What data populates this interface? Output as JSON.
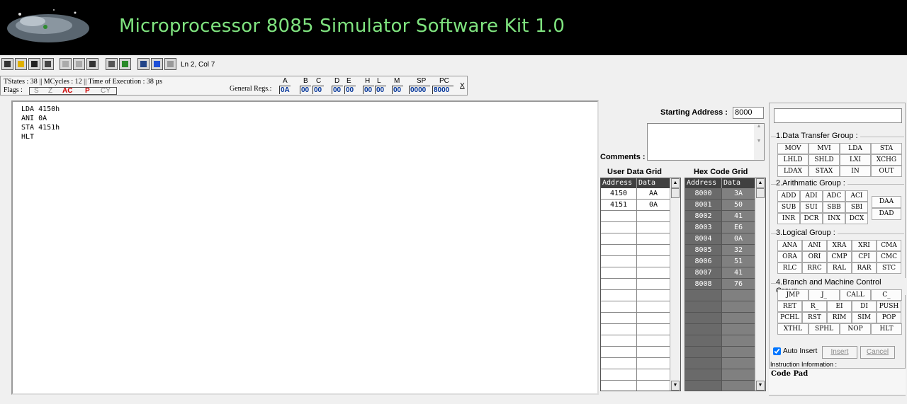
{
  "header": {
    "title": "Microprocessor 8085 Simulator Software Kit 1.0",
    "logo": "spaceship-logo"
  },
  "toolbar": {
    "icons": [
      "new-icon",
      "open-icon",
      "save-icon",
      "print-icon",
      "cut-icon",
      "copy-icon",
      "paste-icon",
      "timer-icon",
      "memory-icon",
      "compile-icon",
      "run-icon",
      "stop-icon"
    ],
    "cursor_pos": "Ln 2, Col 7"
  },
  "status": {
    "line": "TStates : 38 || MCycles : 12 || Time of Execution : 38 µs",
    "flags_label": "Flags :",
    "flags": [
      {
        "name": "S",
        "active": false
      },
      {
        "name": "Z",
        "active": false
      },
      {
        "name": "AC",
        "active": true
      },
      {
        "name": "P",
        "active": true
      },
      {
        "name": "CY",
        "active": false
      }
    ],
    "general_regs_label": "General Regs.:",
    "registers": [
      {
        "name": "A",
        "value": "0A"
      },
      {
        "name": "B",
        "value": "00"
      },
      {
        "name": "C",
        "value": "00"
      },
      {
        "name": "D",
        "value": "00"
      },
      {
        "name": "E",
        "value": "00"
      },
      {
        "name": "H",
        "value": "00"
      },
      {
        "name": "L",
        "value": "00"
      },
      {
        "name": "M",
        "value": "00"
      },
      {
        "name": "SP",
        "value": "0000"
      },
      {
        "name": "PC",
        "value": "8000"
      }
    ],
    "close_label": "X"
  },
  "editor": {
    "lines": [
      "LDA 4150h",
      "ANI 0A",
      "STA 4151h",
      "HLT"
    ]
  },
  "starting_address": {
    "label": "Starting Address :",
    "value": "8000"
  },
  "comments": {
    "label": "Comments :"
  },
  "user_data_grid": {
    "title": "User Data Grid",
    "columns": [
      "Address",
      "Data"
    ],
    "rows": [
      [
        "4150",
        "AA"
      ],
      [
        "4151",
        "0A"
      ]
    ]
  },
  "hex_code_grid": {
    "title": "Hex Code Grid",
    "columns": [
      "Address",
      "Data"
    ],
    "rows": [
      [
        "8000",
        "3A"
      ],
      [
        "8001",
        "50"
      ],
      [
        "8002",
        "41"
      ],
      [
        "8003",
        "E6"
      ],
      [
        "8004",
        "0A"
      ],
      [
        "8005",
        "32"
      ],
      [
        "8006",
        "51"
      ],
      [
        "8007",
        "41"
      ],
      [
        "8008",
        "76"
      ]
    ]
  },
  "instructions": {
    "groups": [
      {
        "label": "1.Data Transfer Group :",
        "rows": [
          [
            "MOV",
            "MVI",
            "LDA",
            "STA"
          ],
          [
            "LHLD",
            "SHLD",
            "LXI",
            "XCHG"
          ],
          [
            "LDAX",
            "STAX",
            "IN",
            "OUT"
          ]
        ]
      },
      {
        "label": "2.Arithmatic  Group :",
        "rows": [
          [
            "ADD",
            "ADI",
            "ADC",
            "ACI"
          ],
          [
            "SUB",
            "SUI",
            "SBB",
            "SBI"
          ],
          [
            "INR",
            "DCR",
            "INX",
            "DCX"
          ]
        ],
        "extra": [
          "DAA",
          "DAD"
        ]
      },
      {
        "label": "3.Logical  Group :",
        "rows": [
          [
            "ANA",
            "ANI",
            "XRA",
            "XRI",
            "CMA"
          ],
          [
            "ORA",
            "ORI",
            "CMP",
            "CPI",
            "CMC"
          ],
          [
            "RLC",
            "RRC",
            "RAL",
            "RAR",
            "STC"
          ]
        ]
      },
      {
        "label": "4.Branch and Machine Control Group",
        "rows": [
          [
            "JMP",
            "J_",
            "CALL",
            "C_"
          ],
          [
            "RET",
            "R_",
            "EI",
            "DI",
            "PUSH"
          ],
          [
            "PCHL",
            "RST",
            "RIM",
            "SIM",
            "POP"
          ],
          [
            "XTHL",
            "SPHL",
            "NOP",
            "HLT"
          ]
        ]
      }
    ],
    "auto_insert_label": "Auto Insert",
    "insert_label": "Insert",
    "cancel_label": "Cancel",
    "info_label": "Instruction Information :",
    "info_text": "Code Pad"
  }
}
